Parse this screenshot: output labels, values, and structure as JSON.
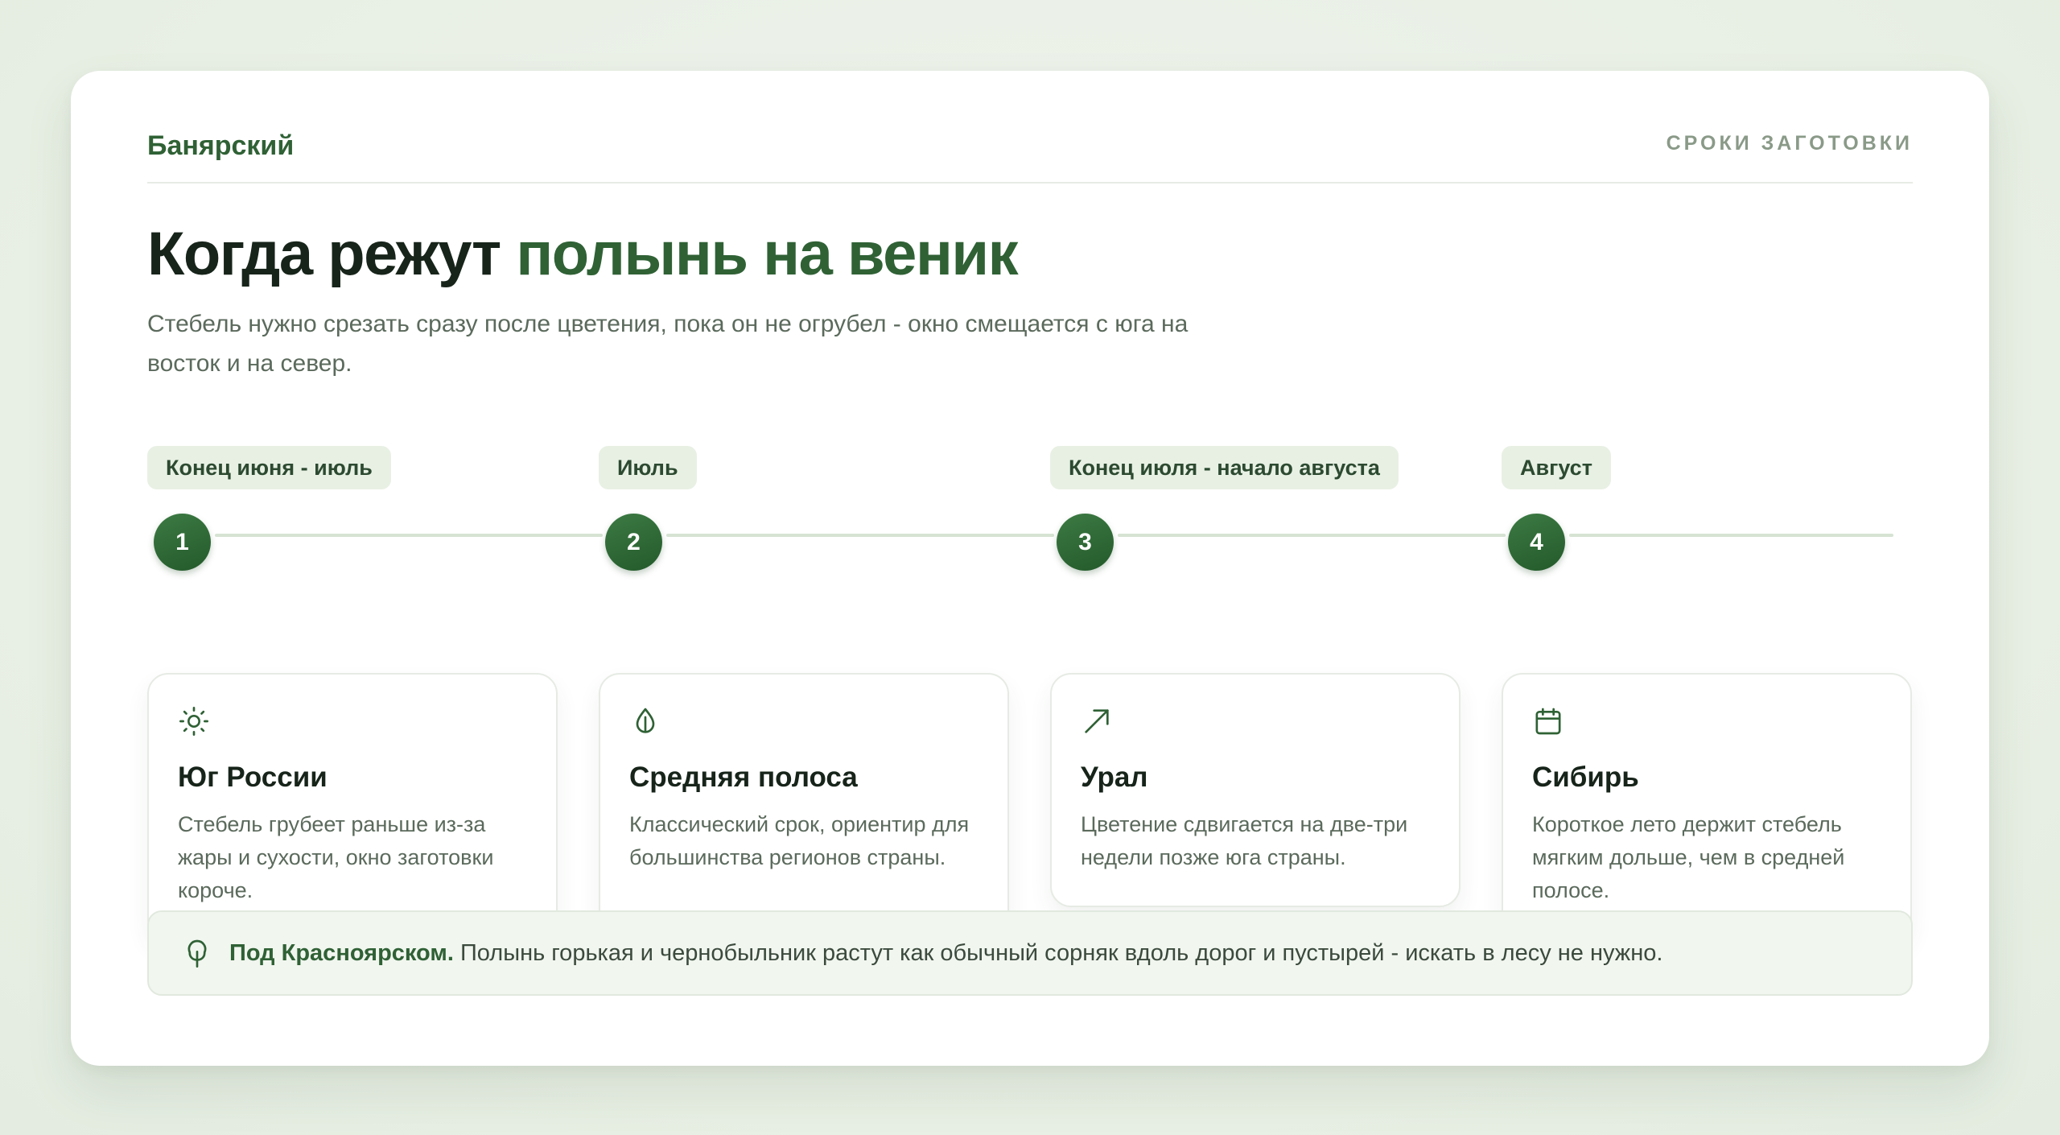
{
  "header": {
    "brand": "Банярский",
    "section": "СРОКИ ЗАГОТОВКИ"
  },
  "hero": {
    "title_plain": "Когда режут ",
    "title_accent": "полынь на веник",
    "lead": "Стебель нужно срезать сразу после цветения, пока он не огрубел - окно смещается с юга на восток и на север."
  },
  "steps": [
    {
      "number": "1",
      "period": "Конец июня - июль",
      "icon": "sun-icon",
      "region": "Юг России",
      "text": "Стебель грубеет раньше из-за жары и сухости, окно заготовки короче."
    },
    {
      "number": "2",
      "period": "Июль",
      "icon": "leaf-drop-icon",
      "region": "Средняя полоса",
      "text": "Классический срок, ориентир для большинства регионов страны."
    },
    {
      "number": "3",
      "period": "Конец июля - начало августа",
      "icon": "arrow-up-right-icon",
      "region": "Урал",
      "text": "Цветение сдвигается на две-три недели позже юга страны."
    },
    {
      "number": "4",
      "period": "Август",
      "icon": "calendar-icon",
      "region": "Сибирь",
      "text": "Короткое лето держит стебель мягким дольше, чем в средней полосе."
    }
  ],
  "note": {
    "icon": "tree-icon",
    "strong": "Под Красноярском.",
    "text": " Полынь горькая и чернобыльник растут как обычный сорняк вдоль дорог и пустырей - искать в лесу не нужно."
  },
  "colors": {
    "accent": "#2f6135",
    "background": "#e9f0e6",
    "tag_bg": "#e8f0e4",
    "note_bg": "#f1f6ef"
  }
}
